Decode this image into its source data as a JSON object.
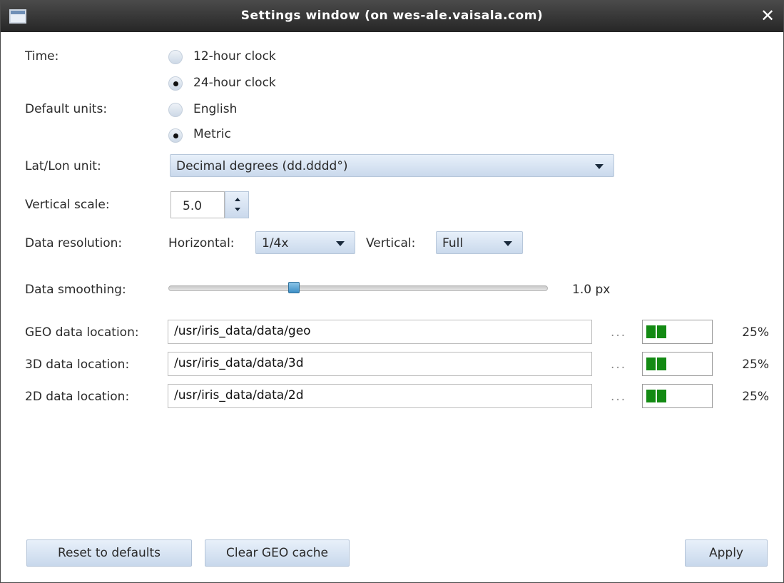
{
  "window": {
    "title": "Settings window (on wes-ale.vaisala.com)",
    "close_glyph": "✕"
  },
  "time": {
    "label": "Time:",
    "options": [
      {
        "label": "12-hour clock",
        "checked": false
      },
      {
        "label": "24-hour clock",
        "checked": true
      }
    ]
  },
  "units": {
    "label": "Default units:",
    "options": [
      {
        "label": "English",
        "checked": false
      },
      {
        "label": "Metric",
        "checked": true
      }
    ]
  },
  "latlon": {
    "label": "Lat/Lon unit:",
    "value": "Decimal degrees (dd.dddd°)"
  },
  "vertical_scale": {
    "label": "Vertical scale:",
    "value": "5.0"
  },
  "data_resolution": {
    "label": "Data resolution:",
    "horizontal_label": "Horizontal:",
    "horizontal_value": "1/4x",
    "vertical_label": "Vertical:",
    "vertical_value": "Full"
  },
  "smoothing": {
    "label": "Data smoothing:",
    "value_text": "1.0 px",
    "level": 0.33
  },
  "locations": [
    {
      "label": "GEO data location:",
      "path": "/usr/iris_data/data/geo",
      "browse": "...",
      "percent": "25%",
      "fill": 0.25
    },
    {
      "label": "3D data location:",
      "path": "/usr/iris_data/data/3d",
      "browse": "...",
      "percent": "25%",
      "fill": 0.25
    },
    {
      "label": "2D data location:",
      "path": "/usr/iris_data/data/2d",
      "browse": "...",
      "percent": "25%",
      "fill": 0.25
    }
  ],
  "buttons": {
    "reset": "Reset to defaults",
    "clear_geo": "Clear GEO cache",
    "apply": "Apply"
  },
  "colors": {
    "meter_fill": "#138a13",
    "slider_thumb": "#3e8fc6",
    "titlebar": "#2f2f2f"
  }
}
